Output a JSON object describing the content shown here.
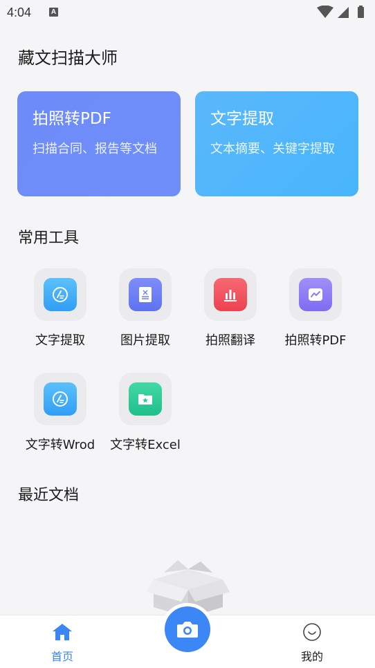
{
  "status_bar": {
    "time": "4:04",
    "notification_icon": "A"
  },
  "app": {
    "title": "藏文扫描大师"
  },
  "feature_cards": [
    {
      "title": "拍照转PDF",
      "subtitle": "扫描合同、报告等文档"
    },
    {
      "title": "文字提取",
      "subtitle": "文本摘要、关键字提取"
    }
  ],
  "sections": {
    "tools_title": "常用工具",
    "recent_title": "最近文档"
  },
  "tools": [
    {
      "label": "文字提取",
      "icon": "text-extract-icon",
      "color": "#3ba9f8"
    },
    {
      "label": "图片提取",
      "icon": "image-extract-icon",
      "color": "#6b7ff5"
    },
    {
      "label": "拍照翻译",
      "icon": "translate-chart-icon",
      "color": "#f2525d"
    },
    {
      "label": "拍照转PDF",
      "icon": "pdf-trend-icon",
      "color": "#8d7cf5"
    },
    {
      "label": "文字转Wrod",
      "icon": "word-convert-icon",
      "color": "#3ba9f8"
    },
    {
      "label": "文字转Excel",
      "icon": "excel-folder-icon",
      "color": "#2ecb96"
    }
  ],
  "bottom_nav": {
    "home_label": "首页",
    "mine_label": "我的",
    "active_color": "#3a86f5"
  }
}
